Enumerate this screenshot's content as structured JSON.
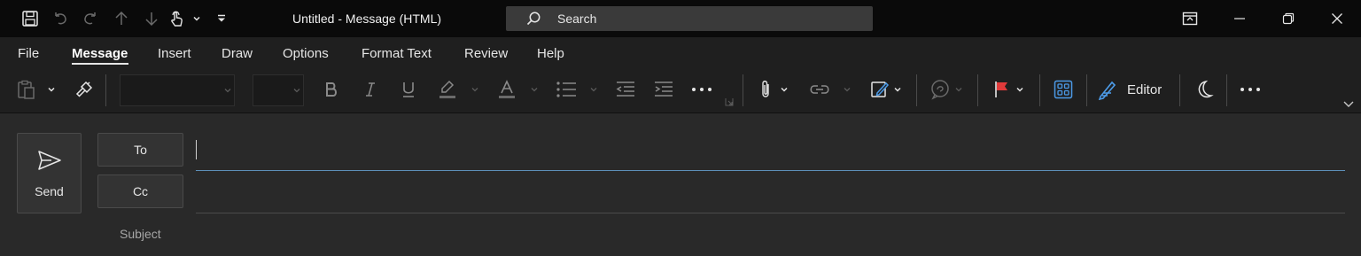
{
  "window": {
    "title": "Untitled  -  Message (HTML)",
    "search_label": "Search"
  },
  "quick_access": {
    "icons": [
      "save-icon",
      "undo-icon",
      "redo-icon",
      "up-arrow-icon",
      "down-arrow-icon",
      "touch-mode-icon",
      "customize-icon"
    ]
  },
  "ribbon": {
    "tabs": [
      {
        "label": "File"
      },
      {
        "label": "Message"
      },
      {
        "label": "Insert"
      },
      {
        "label": "Draw"
      },
      {
        "label": "Options"
      },
      {
        "label": "Format Text"
      },
      {
        "label": "Review"
      },
      {
        "label": "Help"
      }
    ],
    "active_tab": "Message",
    "font_name": "",
    "font_size": "",
    "editor_label": "Editor"
  },
  "compose": {
    "send_label": "Send",
    "to_label": "To",
    "cc_label": "Cc",
    "subject_label": "Subject",
    "to_value": "",
    "cc_value": "",
    "subject_value": ""
  },
  "colors": {
    "titlebar_bg": "#0a0a0a",
    "ribbon_bg": "#1f1f1f",
    "body_bg": "#292929",
    "flag_red": "#e03a3a",
    "accent_blue": "#4c9be8",
    "to_line": "#5d8fb8"
  }
}
